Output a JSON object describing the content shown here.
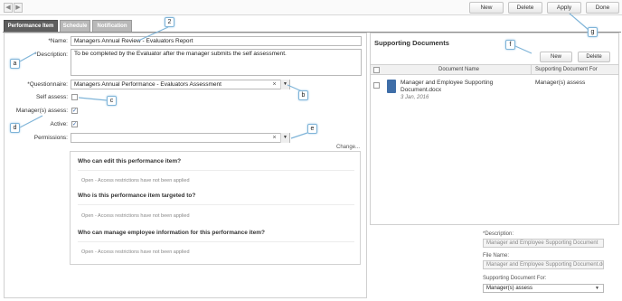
{
  "toolbar": {
    "back_glyph": "◀",
    "forward_glyph": "▶",
    "new": "New",
    "delete": "Delete",
    "apply": "Apply",
    "done": "Done"
  },
  "tabs": [
    {
      "label": "Performance Item",
      "active": true
    },
    {
      "label": "Schedule",
      "active": false
    },
    {
      "label": "Notification",
      "active": false
    }
  ],
  "form": {
    "name_label": "*Name:",
    "name_value": "Managers Annual Review - Evaluators Report",
    "description_label": "*Description:",
    "description_value": "To be completed by the Evaluator after the manager submits the self assessment.",
    "questionnaire_label": "*Questionnaire:",
    "questionnaire_value": "Managers Annual Performance - Evaluators Assessment",
    "self_assess_label": "Self assess:",
    "self_assess_checked": false,
    "managers_assess_label": "Manager(s) assess:",
    "managers_assess_checked": true,
    "active_label": "Active:",
    "active_checked": true,
    "permissions_label": "Permissions:",
    "permissions_value": "",
    "change_link": "Change...",
    "clear_glyph": "×",
    "dropdown_glyph": "▼",
    "check_glyph": "✓"
  },
  "permissions_box": {
    "sections": [
      {
        "heading": "Who can edit this performance item?",
        "note": "Open - Access restrictions have not been applied"
      },
      {
        "heading": "Who is this performance item targeted to?",
        "note": "Open - Access restrictions have not been applied"
      },
      {
        "heading": "Who can manage employee information for this performance item?",
        "note": "Open - Access restrictions have not been applied"
      }
    ]
  },
  "supporting_documents": {
    "title": "Supporting Documents",
    "new": "New",
    "delete": "Delete",
    "col_name": "Document Name",
    "col_for": "Supporting Document For",
    "rows": [
      {
        "name": "Manager and Employee Supporting Document.docx",
        "date": "3 Jan, 2016",
        "for": "Manager(s) assess"
      }
    ]
  },
  "details": {
    "description_label": "*Description:",
    "description_value": "Manager and Employee Supporting Document",
    "filename_label": "File Name:",
    "filename_value": "Manager and Employee Supporting Document.docx",
    "for_label": "Supporting Document For:",
    "for_value": "Manager(s) assess"
  },
  "callouts": {
    "a": "a",
    "b": "b",
    "c": "c",
    "d": "d",
    "e": "e",
    "f": "f",
    "g": "g",
    "two": "2"
  },
  "colors": {
    "active_tab": "#5e5e5e",
    "inactive_tab": "#b9b9b9",
    "callout_border": "#7fb4d8",
    "doc_icon": "#3f6ea8"
  }
}
